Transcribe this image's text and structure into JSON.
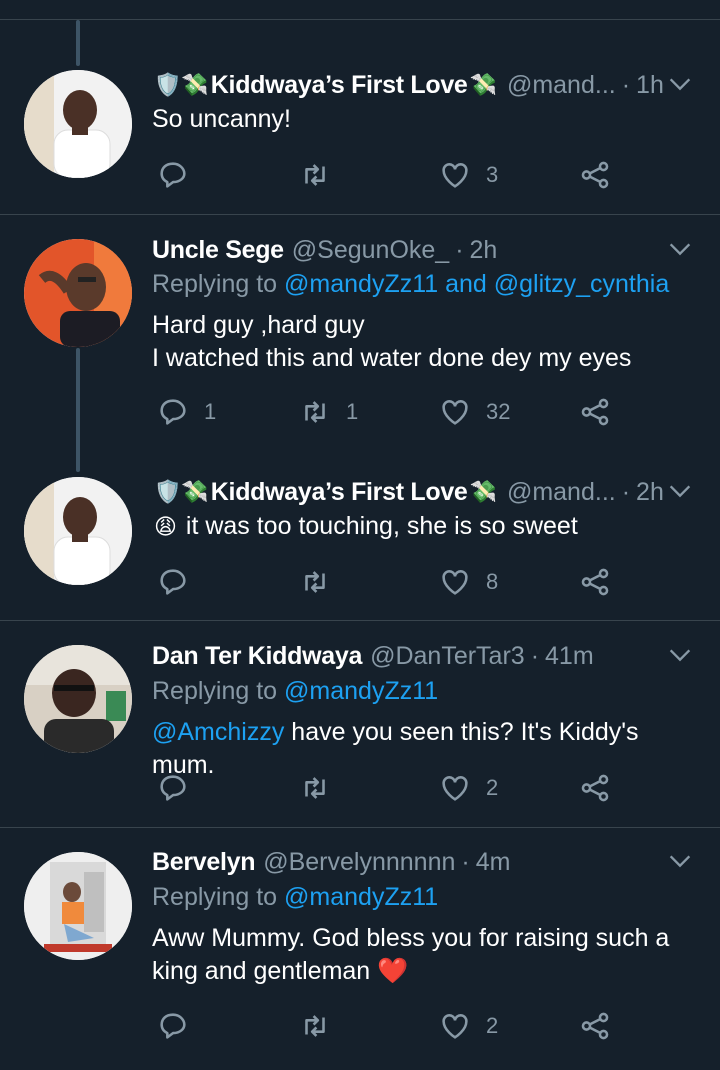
{
  "colors": {
    "background": "#15202b",
    "divider": "#38444d",
    "secondary_text": "#8899a6",
    "link": "#1da1f2"
  },
  "tweets": [
    {
      "name": "⁨Kiddwaya’s First Love⁩",
      "name_text": "Kiddwaya’s First Love",
      "prefix_emoji": "🛡️💸",
      "suffix_emoji": "💸",
      "handle": "@mand...",
      "dot": "·",
      "time": "1h",
      "reply_to_prefix": "",
      "reply_to_links": "",
      "body_line1": "So uncanny!",
      "body_line2": "",
      "reply_count": "",
      "retweet_count": "",
      "like_count": "3"
    },
    {
      "name_text": "Uncle Sege",
      "handle": "@SegunOke_",
      "dot": "·",
      "time": "2h",
      "reply_to_prefix": "Replying to",
      "reply_to_links": "@mandyZz11 and @glitzy_cynthia",
      "body_line1": "Hard guy ,hard guy",
      "body_line2": "I watched this and water done dey my eyes",
      "reply_count": "1",
      "retweet_count": "1",
      "like_count": "32"
    },
    {
      "name_text": "Kiddwaya’s First Love",
      "prefix_emoji": "🛡️💸",
      "suffix_emoji": "💸",
      "handle": "@mand...",
      "dot": "·",
      "time": "2h",
      "body_emoji": "😩",
      "body_line1": "it was too touching, she is so sweet",
      "reply_count": "",
      "retweet_count": "",
      "like_count": "8"
    },
    {
      "name_text": "Dan Ter Kiddwaya",
      "handle": "@DanTerTar3",
      "dot": "·",
      "time": "41m",
      "reply_to_prefix": "Replying to",
      "reply_to_links": "@mandyZz11",
      "body_mention": "@Amchizzy",
      "body_line1": "have you seen this? It's Kiddy's mum.",
      "reply_count": "",
      "retweet_count": "",
      "like_count": "2"
    },
    {
      "name_text": "Bervelyn",
      "handle": "@Bervelynnnnnn",
      "dot": "·",
      "time": "4m",
      "reply_to_prefix": "Replying to",
      "reply_to_links": "@mandyZz11",
      "body_line1": "Aww Mummy. God bless you for raising such a",
      "body_line2": "king and gentleman",
      "body_emoji_end": "❤️",
      "reply_count": "",
      "retweet_count": "",
      "like_count": "2"
    }
  ],
  "icons": {
    "reply": "reply-icon",
    "retweet": "retweet-icon",
    "like": "heart-icon",
    "share": "share-icon",
    "menu": "chevron-down-icon"
  }
}
